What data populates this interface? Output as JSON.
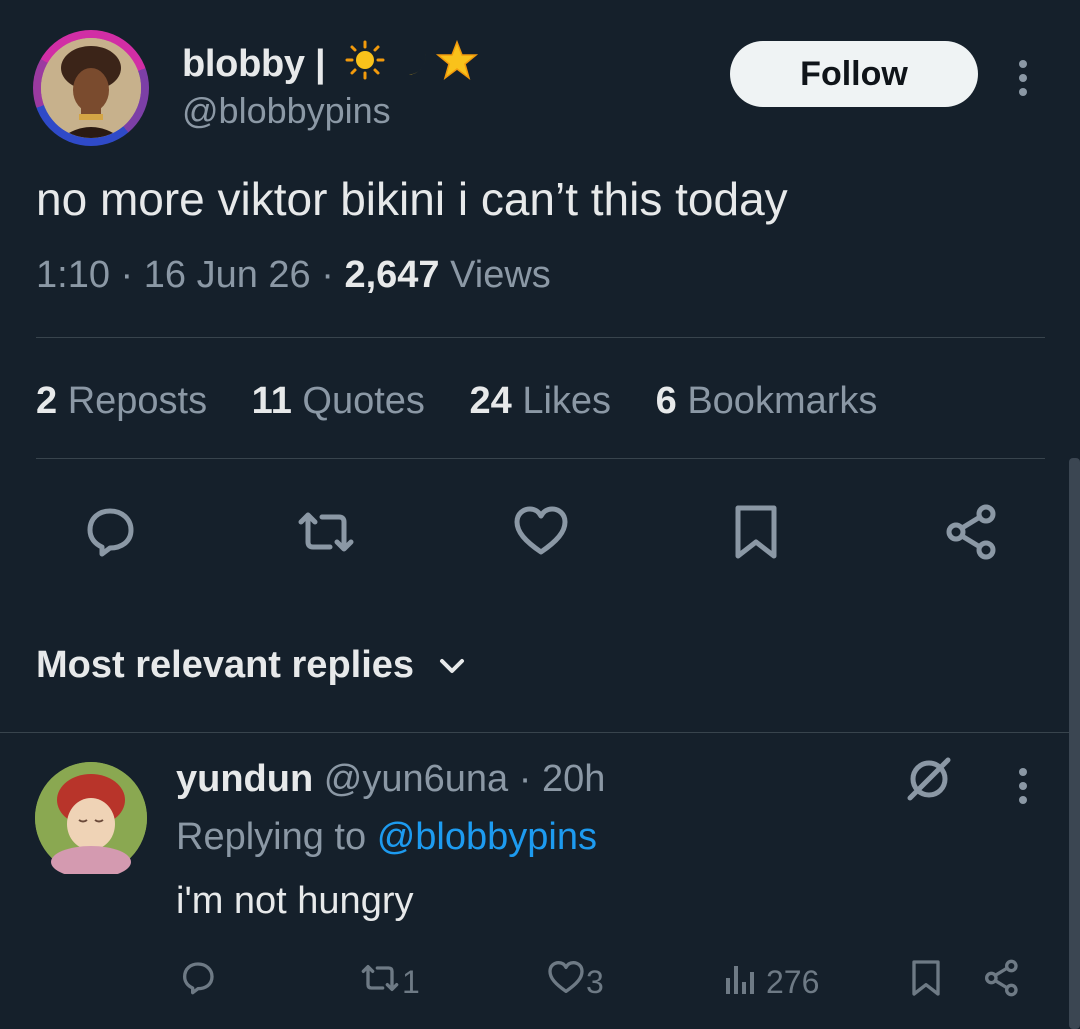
{
  "tweet": {
    "display_name": "blobby |",
    "display_name_emoji": [
      "sun-emoji",
      "crescent-moon-emoji",
      "star-emoji"
    ],
    "handle": "@blobbypins",
    "follow_label": "Follow",
    "text": "no more viktor bikini i can’t this today",
    "time": "1:10",
    "date": "16 Jun 26",
    "views_count": "2,647",
    "views_label": "Views",
    "separator": "·"
  },
  "stats": [
    {
      "count": "2",
      "label": "Reposts"
    },
    {
      "count": "11",
      "label": "Quotes"
    },
    {
      "count": "24",
      "label": "Likes"
    },
    {
      "count": "6",
      "label": "Bookmarks"
    }
  ],
  "actions": [
    "reply-icon",
    "repost-icon",
    "like-icon",
    "bookmark-icon",
    "share-icon"
  ],
  "replies_header": {
    "label": "Most relevant replies"
  },
  "reply": {
    "display_name": "yundun",
    "handle": "@yun6una",
    "separator": "·",
    "time": "20h",
    "replying_to_label": "Replying to",
    "replying_to_handle": "@blobbypins",
    "text": "i'm not hungry",
    "repost_count": "1",
    "like_count": "3",
    "views_count": "276"
  },
  "colors": {
    "background": "#15202b",
    "text": "#e7e9ea",
    "muted": "#8b98a5",
    "link": "#1d9bf0",
    "divider": "#38444d"
  }
}
